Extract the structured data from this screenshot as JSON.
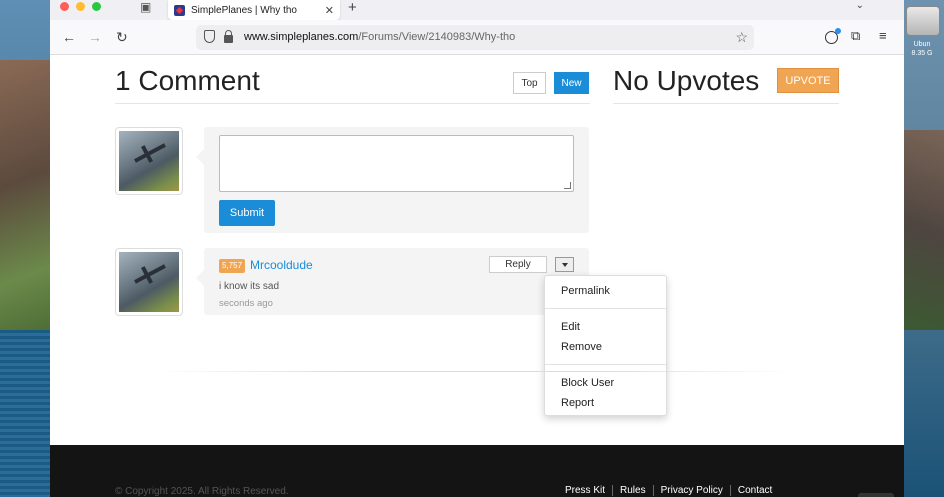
{
  "desktop": {
    "right_label_1": "Ubun",
    "right_label_2": "8.35 G"
  },
  "browser": {
    "tab": {
      "title": "SimplePlanes | Why tho",
      "close": "✕"
    },
    "new_tab": "+",
    "overflow": "⌄",
    "url": {
      "host": "www.simpleplanes.com",
      "path": "/Forums/View/2140983/Why-tho"
    },
    "icons": {
      "back": "←",
      "forward": "→",
      "reload": "↻",
      "star": "☆",
      "extensions": "⧉",
      "menu": "≡"
    }
  },
  "page": {
    "comments_title": "1 Comment",
    "sort": {
      "top": "Top",
      "new": "New"
    },
    "upvotes_title": "No Upvotes",
    "upvote_button": "UPVOTE",
    "form": {
      "submit": "Submit"
    },
    "comment": {
      "rep": "5,757",
      "user": "Mrcooldude",
      "text": "i know its sad",
      "time": "seconds ago",
      "reply": "Reply"
    },
    "dropdown": [
      "Permalink",
      "Edit",
      "Remove",
      "Block User",
      "Report"
    ]
  },
  "footer": {
    "copyright": "© Copyright 2025. All Rights Reserved.",
    "links": [
      "Press Kit",
      "Rules",
      "Privacy Policy",
      "Contact"
    ]
  },
  "colors": {
    "accent": "#1a8cd8",
    "upvote": "#f0a553",
    "footer": "#141414"
  }
}
